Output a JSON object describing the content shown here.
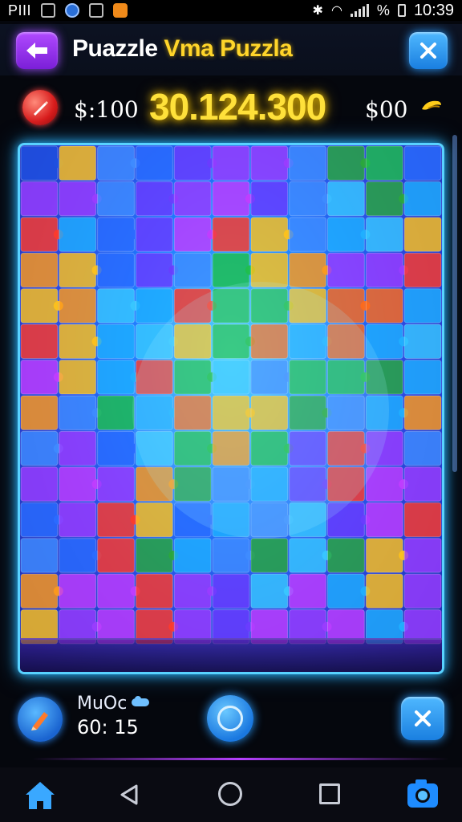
{
  "status_bar": {
    "left_text": "PIII",
    "time": "10:39",
    "battery_text": "%"
  },
  "header": {
    "title_part1": "Puazzle",
    "title_part2": "Vma Puzzla"
  },
  "score_bar": {
    "coins_left": "$:100",
    "score": "30.124.300",
    "coins_right": "$00"
  },
  "controls": {
    "moves_label": "MuOc",
    "moves_value": "60: 15"
  },
  "icons": {
    "back": "arrow-left-icon",
    "close": "close-icon",
    "hint": "pencil-icon",
    "coin": "coin-icon",
    "pen": "pen-icon",
    "center": "circle-icon",
    "home": "home-icon",
    "screenshot": "camera-icon"
  },
  "colors": {
    "accent_purple": "#a24cff",
    "accent_blue": "#2a9cff",
    "score_yellow": "#ffe13a",
    "board_border": "#58d2ff"
  }
}
